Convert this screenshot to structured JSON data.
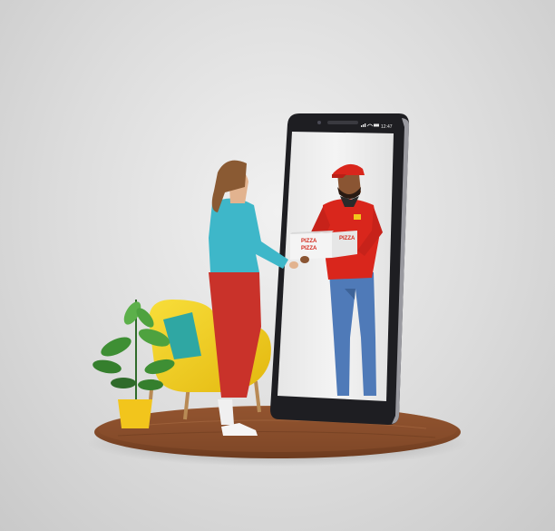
{
  "phone": {
    "status_time": "12:47"
  },
  "pizza_boxes": {
    "left_label_line1": "PIZZA",
    "left_label_line2": "PIZZA",
    "right_label": "PIZZA"
  },
  "colors": {
    "background": "#d9d9d9",
    "platform_wood": "#8a4f2c",
    "chair_yellow": "#f3d21e",
    "pot_yellow": "#f2c51c",
    "courier_red": "#d9261c",
    "courier_jeans": "#4f7ab8",
    "woman_top_teal": "#3eb7c9",
    "woman_pants_red": "#c9322a",
    "phone_frame": "#1e1e22"
  },
  "icons": [
    "wifi-icon",
    "signal-icon",
    "battery-icon",
    "camera-icon"
  ]
}
